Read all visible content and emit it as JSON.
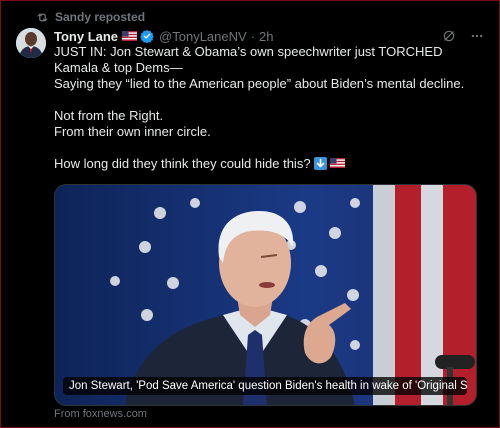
{
  "repost": {
    "text": "Sandy reposted",
    "icon": "repost-icon"
  },
  "author": {
    "name": "Tony Lane",
    "handle": "@TonyLaneNV",
    "separator": "·",
    "time": "2h",
    "flag_icon": "us-flag-icon",
    "verified_icon": "verified-badge-icon"
  },
  "tweet": {
    "line1": "JUST IN: Jon Stewart & Obama’s own speechwriter just TORCHED Kamala & top Dems—",
    "line2": "Saying they “lied to the American people” about Biden’s mental decline.",
    "line3": "Not from the Right.",
    "line4": "From their own inner circle.",
    "line5": "How long did they think they could hide this?"
  },
  "link_card": {
    "title": "Jon Stewart, 'Pod Save America' question Biden's health in wake of 'Original Si...",
    "source": "From foxnews.com"
  },
  "colors": {
    "background": "#000000",
    "text": "#e7e9ea",
    "muted": "#71767b",
    "verified": "#1d9bf0",
    "frame": "#7a1010"
  }
}
